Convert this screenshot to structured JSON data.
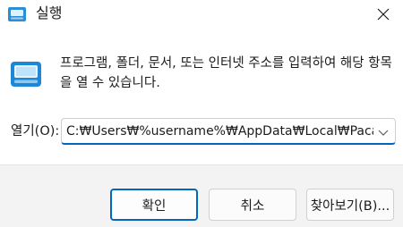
{
  "window": {
    "title": "실행",
    "icon": "run-app-icon",
    "close_icon": "close-icon"
  },
  "content": {
    "description": "프로그램, 폴더, 문서, 또는 인터넷 주소를 입력하여 해당 항목을 열 수 있습니다.",
    "open_label": "열기(O):",
    "open_value": "C:₩Users₩%username%₩AppData₩Local₩Pacakges",
    "dropdown_icon": "chevron-down-icon"
  },
  "buttons": {
    "ok": "확인",
    "cancel": "취소",
    "browse": "찾아보기(B)..."
  },
  "colors": {
    "accent": "#0067c0",
    "footer_bg": "#f3f3f3"
  }
}
